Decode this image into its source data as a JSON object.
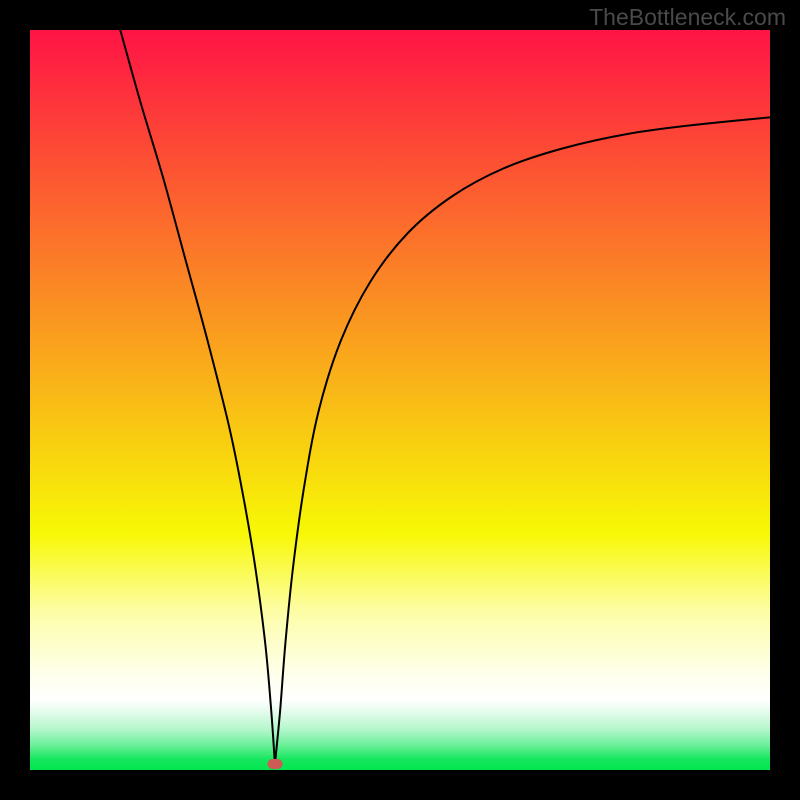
{
  "watermark": "TheBottleneck.com",
  "marker": {
    "x_pct": 33.1,
    "y_pct": 99.2,
    "color": "#cc5a55"
  },
  "gradient_stops": [
    {
      "offset": 0.0,
      "color": "#fe1345"
    },
    {
      "offset": 0.14,
      "color": "#fd4337"
    },
    {
      "offset": 0.32,
      "color": "#fb7f27"
    },
    {
      "offset": 0.5,
      "color": "#f9bb16"
    },
    {
      "offset": 0.68,
      "color": "#f7f805"
    },
    {
      "offset": 0.78,
      "color": "#fdfd9f"
    },
    {
      "offset": 0.81,
      "color": "#fdfebb"
    },
    {
      "offset": 0.87,
      "color": "#feffea"
    },
    {
      "offset": 0.905,
      "color": "#ffffff"
    },
    {
      "offset": 0.92,
      "color": "#e7fcee"
    },
    {
      "offset": 0.945,
      "color": "#b4f7cb"
    },
    {
      "offset": 0.965,
      "color": "#70f09d"
    },
    {
      "offset": 0.985,
      "color": "#18e760"
    },
    {
      "offset": 1.0,
      "color": "#01e54e"
    }
  ],
  "chart_data": {
    "type": "line",
    "title": "",
    "xlabel": "",
    "ylabel": "",
    "xlim": [
      0,
      100
    ],
    "ylim": [
      0,
      100
    ],
    "grid": false,
    "legend": false,
    "series": [
      {
        "name": "bottleneck-curve",
        "x": [
          12.2,
          15.0,
          18.0,
          21.0,
          24.0,
          27.0,
          29.0,
          30.5,
          31.8,
          32.6,
          33.1,
          33.8,
          34.5,
          35.5,
          37.0,
          39.0,
          42.0,
          46.0,
          51.0,
          57.0,
          64.0,
          72.0,
          81.0,
          90.0,
          100.0
        ],
        "y": [
          100.0,
          90.0,
          80.0,
          69.0,
          58.0,
          46.0,
          36.0,
          27.0,
          17.0,
          8.0,
          0.8,
          8.0,
          17.0,
          27.0,
          38.0,
          48.5,
          58.0,
          66.0,
          72.5,
          77.5,
          81.3,
          84.0,
          86.0,
          87.2,
          88.2
        ]
      }
    ],
    "annotations": [
      {
        "type": "marker",
        "x": 33.1,
        "y": 0.8,
        "label": ""
      }
    ]
  }
}
